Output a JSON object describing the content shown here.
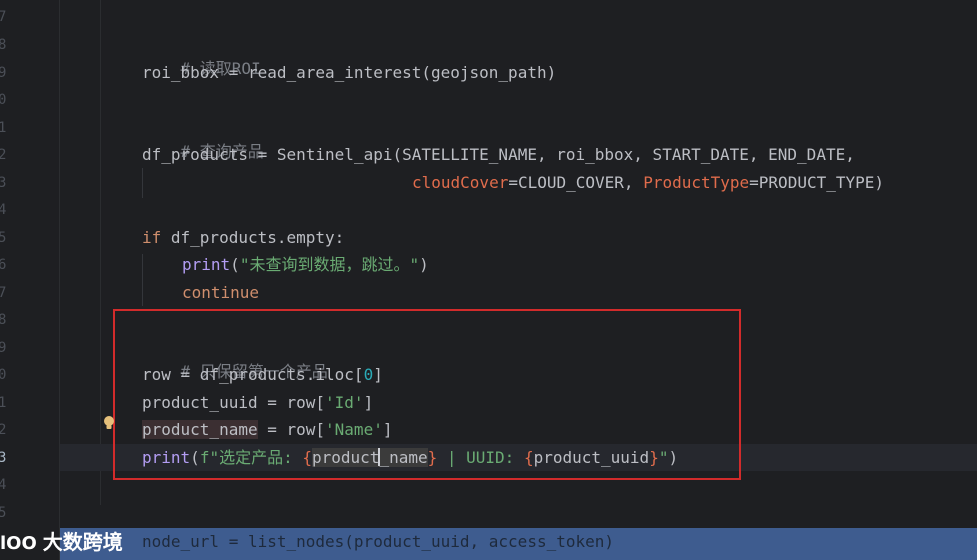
{
  "editor": {
    "line_numbers": [
      "7",
      "8",
      "9",
      "0",
      "1",
      "2",
      "3",
      "4",
      "5",
      "6",
      "7",
      "8",
      "9",
      "0",
      "1",
      "2",
      "3",
      "4",
      "5"
    ],
    "lines": {
      "comment_read_roi": "# 读取ROI",
      "roi_bbox_var": "roi_bbox",
      "roi_bbox_eq": " = ",
      "read_area_fn": "read_area_interest",
      "read_area_args": "(geojson_path)",
      "comment_query": "# 查询产品",
      "df_products_var": "df_products",
      "df_eq": " = ",
      "sentinel_fn": "Sentinel_api",
      "sentinel_args": "(SATELLITE_NAME, roi_bbox, START_DATE, END_DATE,",
      "kw_cloudcover": "cloudCover",
      "val_cloudcover": "=CLOUD_COVER, ",
      "kw_producttype": "ProductType",
      "val_producttype": "=PRODUCT_TYPE)",
      "if_kw": "if",
      "if_rest": " df_products.empty:",
      "print_fn": "print",
      "print_open": "(",
      "print_str": "\"未查询到数据，跳过。\"",
      "print_close": ")",
      "continue_kw": "continue",
      "comment_keep": "# 只保留第一个产品",
      "row_var": "row = df_products.iloc[",
      "row_idx": "0",
      "row_close": "]",
      "uuid_var": "product_uuid",
      "uuid_eq": " = row[",
      "uuid_key": "'Id'",
      "uuid_close": "]",
      "name_var": "product_name",
      "name_eq": " = row[",
      "name_key": "'Name'",
      "name_close": "]",
      "print2_fn": "print",
      "print2_open": "(",
      "print2_fstr_a": "f\"选定产品: ",
      "print2_brace_open": "{",
      "print2_name_a": "product",
      "print2_name_b": "_name",
      "print2_brace_close": "}",
      "print2_mid": " | UUID: ",
      "print2_brace2_open": "{",
      "print2_uuid": "product_uuid",
      "print2_brace2_close": "}",
      "print2_end": "\"",
      "print2_close": ")",
      "bottom_line": "node_url = list_nodes(product_uuid, access_token)"
    }
  },
  "watermark": {
    "logo": "lOO",
    "text": "大数跨境"
  },
  "colors": {
    "background": "#1e1f22",
    "highlight_box": "#d22b2b",
    "bottom_bar": "#3e5c8f"
  }
}
